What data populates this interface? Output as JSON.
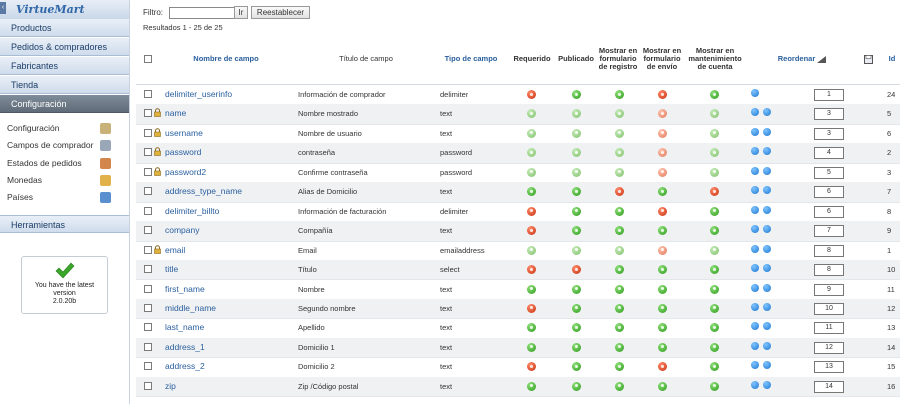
{
  "sidebar": {
    "brand": "VirtueMart",
    "menu": [
      {
        "label": "Productos"
      },
      {
        "label": "Pedidos & compradores"
      },
      {
        "label": "Fabricantes"
      },
      {
        "label": "Tienda"
      },
      {
        "label": "Configuración"
      }
    ],
    "submenu": [
      {
        "label": "Configuración",
        "icon": "tools-icon",
        "color": "#c9b27a"
      },
      {
        "label": "Campos de comprador",
        "icon": "form-icon",
        "color": "#9aa7b8"
      },
      {
        "label": "Estados de pedidos",
        "icon": "status-icon",
        "color": "#d2864c"
      },
      {
        "label": "Monedas",
        "icon": "coins-icon",
        "color": "#e1b24a"
      },
      {
        "label": "Países",
        "icon": "globe-icon",
        "color": "#5a8fcf"
      }
    ],
    "tools_label": "Herramientas",
    "version": {
      "line1": "You have the latest",
      "line2": "version",
      "line3": "2.0.20b"
    }
  },
  "filter": {
    "label": "Filtro:",
    "value": "",
    "go_label": "Ir",
    "reset_label": "Reestablecer"
  },
  "results_text": "Resultados 1 - 25 de 25",
  "columns": {
    "name": "Nombre de campo",
    "title": "Título de campo",
    "type": "Tipo de campo",
    "required": "Requerido",
    "published": "Publicado",
    "registration": "Mostrar en formulario de registro",
    "shipment": "Mostrar en formulario de envío",
    "account": "Mostrar en mantenimiento de cuenta",
    "reorder": "Reordenar",
    "id": "Id"
  },
  "rows": [
    {
      "name": "delimiter_userinfo",
      "title": "Información de comprador",
      "type": "delimiter",
      "locked": false,
      "req": "r",
      "pub": "g",
      "reg": "g",
      "ship": "r",
      "acc": "g",
      "light": false,
      "up": false,
      "order": "1",
      "id": "24"
    },
    {
      "name": "name",
      "title": "Nombre mostrado",
      "type": "text",
      "locked": true,
      "req": "g",
      "pub": "g",
      "reg": "g",
      "ship": "r",
      "acc": "g",
      "light": true,
      "up": true,
      "order": "3",
      "id": "5"
    },
    {
      "name": "username",
      "title": "Nombre de usuario",
      "type": "text",
      "locked": true,
      "req": "g",
      "pub": "g",
      "reg": "g",
      "ship": "r",
      "acc": "g",
      "light": true,
      "up": true,
      "order": "3",
      "id": "6"
    },
    {
      "name": "password",
      "title": "contraseña",
      "type": "password",
      "locked": true,
      "req": "g",
      "pub": "g",
      "reg": "g",
      "ship": "r",
      "acc": "g",
      "light": true,
      "up": true,
      "order": "4",
      "id": "2"
    },
    {
      "name": "password2",
      "title": "Confirme contraseña",
      "type": "password",
      "locked": true,
      "req": "g",
      "pub": "g",
      "reg": "g",
      "ship": "r",
      "acc": "g",
      "light": true,
      "up": true,
      "order": "5",
      "id": "3"
    },
    {
      "name": "address_type_name",
      "title": "Alias de Domicilio",
      "type": "text",
      "locked": false,
      "req": "g",
      "pub": "g",
      "reg": "r",
      "ship": "g",
      "acc": "r",
      "light": false,
      "up": true,
      "order": "6",
      "id": "7"
    },
    {
      "name": "delimiter_billto",
      "title": "Información de facturación",
      "type": "delimiter",
      "locked": false,
      "req": "r",
      "pub": "g",
      "reg": "g",
      "ship": "r",
      "acc": "g",
      "light": false,
      "up": true,
      "order": "6",
      "id": "8"
    },
    {
      "name": "company",
      "title": "Compañía",
      "type": "text",
      "locked": false,
      "req": "r",
      "pub": "g",
      "reg": "g",
      "ship": "g",
      "acc": "g",
      "light": false,
      "up": true,
      "order": "7",
      "id": "9"
    },
    {
      "name": "email",
      "title": "Email",
      "type": "emailaddress",
      "locked": true,
      "req": "g",
      "pub": "g",
      "reg": "g",
      "ship": "r",
      "acc": "g",
      "light": true,
      "up": true,
      "order": "8",
      "id": "1"
    },
    {
      "name": "title",
      "title": "Título",
      "type": "select",
      "locked": false,
      "req": "r",
      "pub": "r",
      "reg": "g",
      "ship": "g",
      "acc": "g",
      "light": false,
      "up": true,
      "order": "8",
      "id": "10"
    },
    {
      "name": "first_name",
      "title": "Nombre",
      "type": "text",
      "locked": false,
      "req": "g",
      "pub": "g",
      "reg": "g",
      "ship": "g",
      "acc": "g",
      "light": false,
      "up": true,
      "order": "9",
      "id": "11"
    },
    {
      "name": "middle_name",
      "title": "Segundo nombre",
      "type": "text",
      "locked": false,
      "req": "r",
      "pub": "g",
      "reg": "g",
      "ship": "g",
      "acc": "g",
      "light": false,
      "up": true,
      "order": "10",
      "id": "12"
    },
    {
      "name": "last_name",
      "title": "Apellido",
      "type": "text",
      "locked": false,
      "req": "g",
      "pub": "g",
      "reg": "g",
      "ship": "g",
      "acc": "g",
      "light": false,
      "up": true,
      "order": "11",
      "id": "13"
    },
    {
      "name": "address_1",
      "title": "Domicilio 1",
      "type": "text",
      "locked": false,
      "req": "g",
      "pub": "g",
      "reg": "g",
      "ship": "g",
      "acc": "g",
      "light": false,
      "up": true,
      "order": "12",
      "id": "14"
    },
    {
      "name": "address_2",
      "title": "Domicilio 2",
      "type": "text",
      "locked": false,
      "req": "r",
      "pub": "g",
      "reg": "g",
      "ship": "r",
      "acc": "g",
      "light": false,
      "up": true,
      "order": "13",
      "id": "15"
    },
    {
      "name": "zip",
      "title": "Zip /Código postal",
      "type": "text",
      "locked": false,
      "req": "g",
      "pub": "g",
      "reg": "g",
      "ship": "g",
      "acc": "g",
      "light": false,
      "up": true,
      "order": "14",
      "id": "16"
    }
  ]
}
